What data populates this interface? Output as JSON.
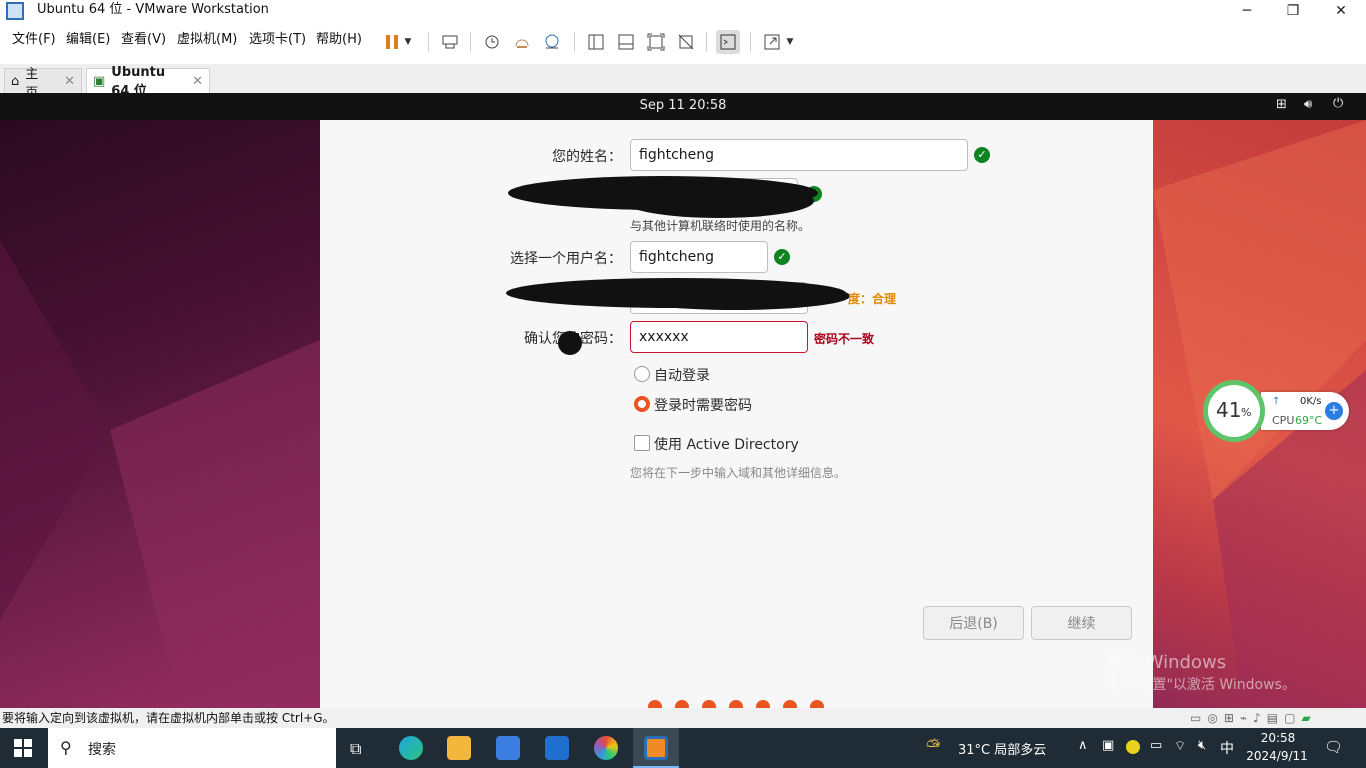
{
  "window": {
    "title": "Ubuntu 64 位 - VMware Workstation"
  },
  "menus": [
    "文件(F)",
    "编辑(E)",
    "查看(V)",
    "虚拟机(M)",
    "选项卡(T)",
    "帮助(H)"
  ],
  "tabs": [
    {
      "label": "主页"
    },
    {
      "label": "Ubuntu 64 位"
    }
  ],
  "vm_topbar": {
    "datetime": "Sep 11  20:58"
  },
  "form": {
    "name_label": "您的姓名：",
    "name_value": "fightcheng",
    "computer_hint": "与其他计算机联络时使用的名称。",
    "username_label": "选择一个用户名：",
    "username_value": "fightcheng",
    "strength_text": "度：合理",
    "confirm_label": "确认您的密码：",
    "confirm_value": "xxxxxx",
    "mismatch_text": "密码不一致",
    "auto_login": "自动登录",
    "require_password": "登录时需要密码",
    "active_directory": "使用 Active Directory",
    "ad_hint": "您将在下一步中输入域和其他详细信息。",
    "back_button": "后退(B)",
    "continue_button": "继续"
  },
  "watermark": {
    "line1": "激活 Windows",
    "line2": "转到\"设置\"以激活 Windows。"
  },
  "widget": {
    "percent": "41",
    "percent_sign": "%",
    "net": "0K/s",
    "cpu_label": "CPU",
    "cpu_temp": "69°C"
  },
  "statusbar": {
    "text": "要将输入定向到该虚拟机，请在虚拟机内部单击或按 Ctrl+G。"
  },
  "taskbar": {
    "search_placeholder": "搜索",
    "weather": "31°C  局部多云",
    "ime": "中",
    "time": "20:58",
    "date": "2024/9/11"
  },
  "progress": {
    "steps": 7,
    "current": 7
  },
  "colors": {
    "accent": "#e95420",
    "success": "#0e8420",
    "error": "#c7162b"
  }
}
